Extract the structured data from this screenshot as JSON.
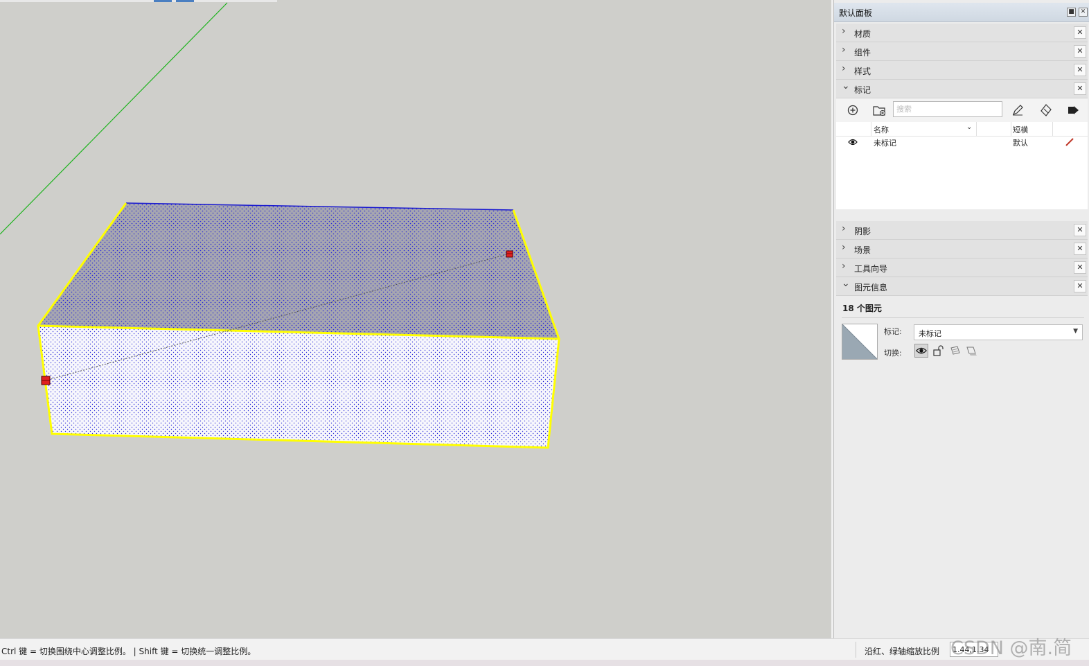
{
  "panel": {
    "title": "默认面板",
    "pin_glyph": "■",
    "close_glyph": "✕"
  },
  "trays_top": [
    {
      "label": "材质",
      "expanded": false
    },
    {
      "label": "组件",
      "expanded": false
    },
    {
      "label": "样式",
      "expanded": false
    },
    {
      "label": "标记",
      "expanded": true
    }
  ],
  "tags": {
    "search_placeholder": "搜索",
    "columns": {
      "name": "名称",
      "dash": "短横"
    },
    "rows": [
      {
        "visible_icon": "eye-icon",
        "name": "未标记",
        "dash": "默认",
        "color": "#c0392b"
      }
    ]
  },
  "trays_bottom": [
    {
      "label": "阴影",
      "expanded": false
    },
    {
      "label": "场景",
      "expanded": false
    },
    {
      "label": "工具向导",
      "expanded": false
    },
    {
      "label": "图元信息",
      "expanded": true
    }
  ],
  "entity_info": {
    "count_label": "18 个图元",
    "tag_label": "标记:",
    "tag_value": "未标记",
    "toggle_label": "切换:",
    "toggles": [
      "eye-icon",
      "unlock-icon",
      "receive-shadow-icon",
      "cast-shadow-icon"
    ]
  },
  "status": {
    "hint": "Ctrl 键 = 切换围绕中心调整比例。 | Shift 键 = 切换统一调整比例。",
    "measure_label": "沿红、绿轴缩放比例",
    "measure_value": "1.44,1.34"
  },
  "watermark": "CSDN @南.简",
  "colors": {
    "viewport_bg": "#cfcfcb",
    "selection": "#ffff00",
    "green_axis": "#1db31d",
    "top_face": "#a6a6b0",
    "front_face": "#f7f7fc",
    "grip": "#e02020"
  }
}
